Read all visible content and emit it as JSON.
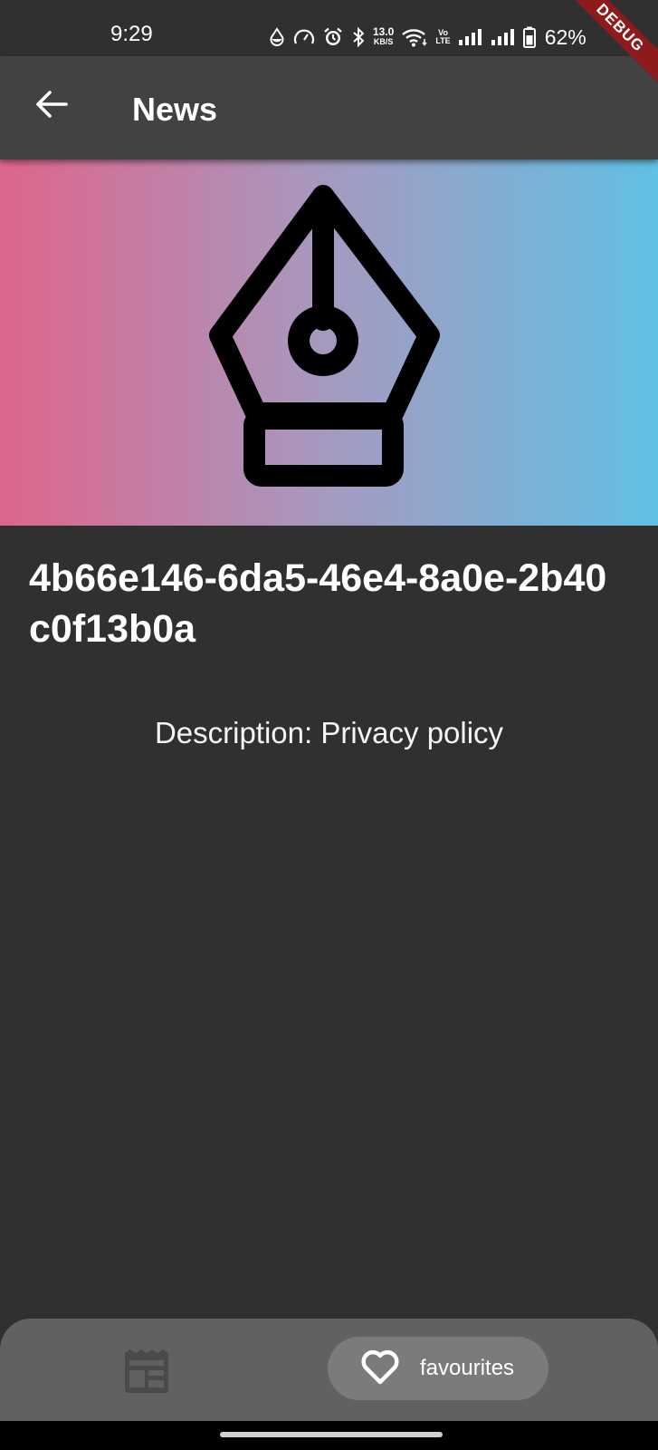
{
  "status_bar": {
    "time": "9:29",
    "net_speed_value": "13.0",
    "net_speed_unit": "KB/S",
    "volte_top": "Vo",
    "volte_bottom": "LTE",
    "battery_percent": "62%",
    "icons": [
      "data-saver-icon",
      "speedometer-icon",
      "alarm-icon",
      "bluetooth-icon",
      "wifi-icon",
      "volte-icon",
      "signal-icon",
      "signal-icon",
      "battery-icon"
    ]
  },
  "debug_banner": "DEBUG",
  "app_bar": {
    "title": "News",
    "back_icon": "arrow-back-icon"
  },
  "hero": {
    "icon": "pen-nib-icon",
    "gradient": [
      "#de658c",
      "#a898be",
      "#61c0e4"
    ]
  },
  "article": {
    "title": "4b66e146-6da5-46e4-8a0e-2b40c0f13b0a",
    "description": "Description: Privacy policy"
  },
  "bottom_nav": {
    "items": [
      {
        "icon": "newspaper-icon",
        "label": "",
        "selected": false
      },
      {
        "icon": "heart-icon",
        "label": "favourites",
        "selected": true
      }
    ]
  },
  "colors": {
    "background": "#303030",
    "app_bar": "#424242",
    "bottom_nav": "#616161",
    "selected_pill": "#7b7b7b",
    "debug": "#8e1b1b"
  }
}
